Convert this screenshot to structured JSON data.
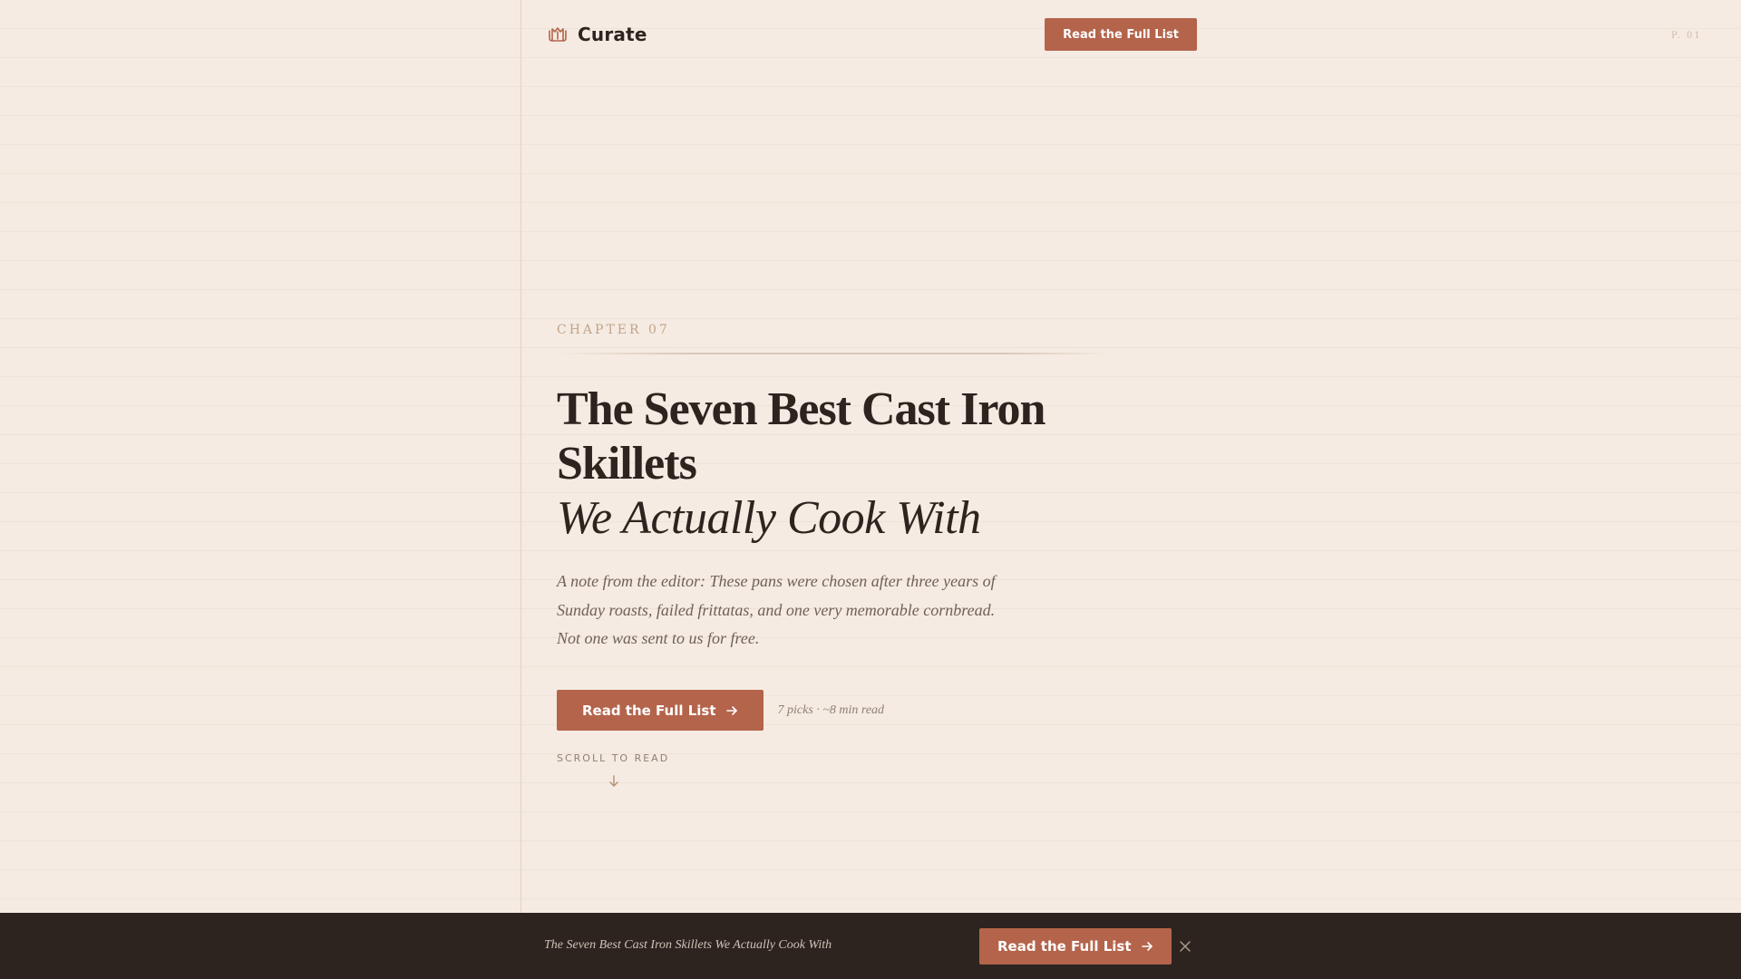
{
  "header": {
    "brand": "Curate",
    "cta_label": "Read the Full List",
    "brand_icon": "crown-icon"
  },
  "page_marker": "P. 01",
  "hero": {
    "chapter": "CHAPTER 07",
    "title_line_1": "The Seven Best Cast Iron",
    "title_line_2": "Skillets",
    "title_italic": "We Actually Cook With",
    "editor_note": "A note from the editor: These pans were chosen after three years of Sunday roasts, failed frittatas, and one very memorable cornbread. Not one was sent to us for free.",
    "cta_label": "Read the Full List",
    "meta": "7 picks · ~8 min read",
    "scroll_label": "SCROLL TO READ"
  },
  "sticky_bar": {
    "title": "The Seven Best Cast Iron Skillets We Actually Cook With",
    "cta_label": "Read the Full List",
    "close_icon": "close-icon"
  },
  "colors": {
    "background": "#f5ebe2",
    "accent": "#b4644b",
    "text": "#2d2420",
    "bar": "#2d2420",
    "muted": "#8e7f74",
    "chapter": "#c2a48a"
  }
}
